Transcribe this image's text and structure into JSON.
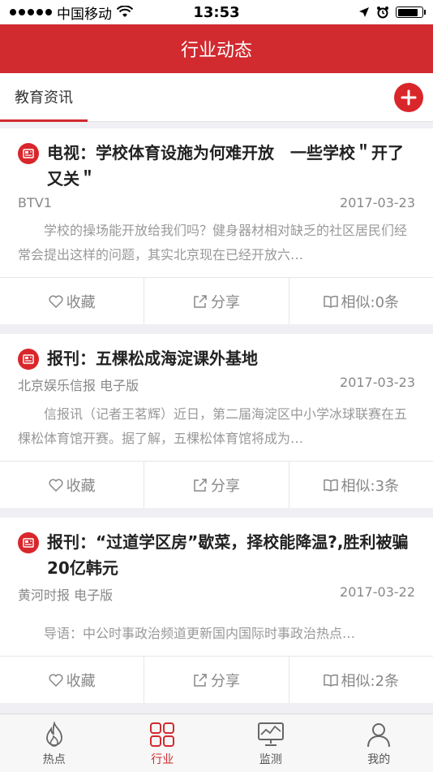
{
  "status_bar": {
    "carrier": "中国移动",
    "time": "13:53"
  },
  "nav": {
    "title": "行业动态"
  },
  "tabs": {
    "active_label": "教育资讯"
  },
  "articles": [
    {
      "title": "电视：学校体育设施为何难开放　一些学校＂开了又关＂",
      "source": "BTV1",
      "date": "2017-03-23",
      "summary": "学校的操场能开放给我们吗？健身器材相对缺乏的社区居民们经常会提出这样的问题，其实北京现在已经开放六…",
      "collect": "收藏",
      "share": "分享",
      "similar": "相似:0条"
    },
    {
      "title": "报刊：五棵松成海淀课外基地",
      "source": "北京娱乐信报 电子版",
      "date": "2017-03-23",
      "summary": "信报讯（记者王茗辉）近日，第二届海淀区中小学冰球联赛在五棵松体育馆开赛。据了解，五棵松体育馆将成为…",
      "collect": "收藏",
      "share": "分享",
      "similar": "相似:3条"
    },
    {
      "title": "报刊：“过道学区房”歇菜，择校能降温?,胜利被骗20亿韩元",
      "source": "黄河时报 电子版",
      "date": "2017-03-22",
      "summary": "导语：中公时事政治频道更新国内国际时事政治热点…",
      "collect": "收藏",
      "share": "分享",
      "similar": "相似:2条"
    }
  ],
  "tab_bar": {
    "items": [
      {
        "label": "热点",
        "icon": "flame-icon"
      },
      {
        "label": "行业",
        "icon": "grid-icon"
      },
      {
        "label": "监测",
        "icon": "monitor-icon"
      },
      {
        "label": "我的",
        "icon": "person-icon"
      }
    ],
    "active_color": "#d12a2f"
  },
  "colors": {
    "brand_red": "#d12a2f",
    "background": "#efeff4"
  }
}
